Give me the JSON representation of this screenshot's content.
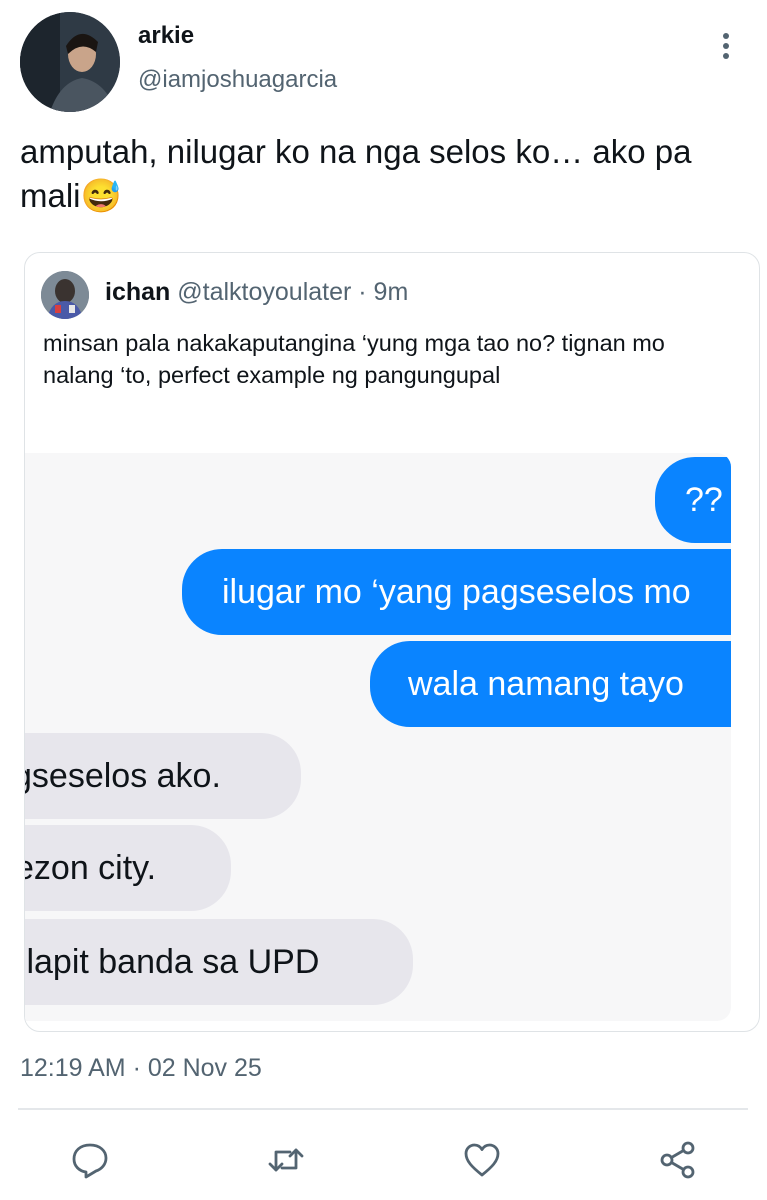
{
  "author": {
    "name": "arkie",
    "handle": "@iamjoshuagarcia"
  },
  "post": {
    "text": "amputah, nilugar ko na nga selos ko… ako pa mali😅"
  },
  "quoted": {
    "name": "ichan",
    "handle": "@talktoyoulater",
    "separator": " · ",
    "age": "9m",
    "text": "minsan pala nakakaputangina ‘yung mga tao no? tignan mo nalang ‘to, perfect example ng pangungupal",
    "screenshot": {
      "sent": [
        "??",
        "ilugar mo ‘yang pagseselos mo",
        "wala namang tayo"
      ],
      "received": [
        "gseselos ako.",
        "ezon city.",
        "ılapit banda sa UPD"
      ]
    }
  },
  "timestamp": "12:19 AM · 02 Nov 25",
  "actions": {
    "icons": [
      "reply-icon",
      "retweet-icon",
      "like-icon",
      "share-icon"
    ]
  },
  "colors": {
    "accent_bubble": "#0a84ff",
    "received_bubble": "#e7e6ec",
    "secondary_text": "#536471"
  }
}
